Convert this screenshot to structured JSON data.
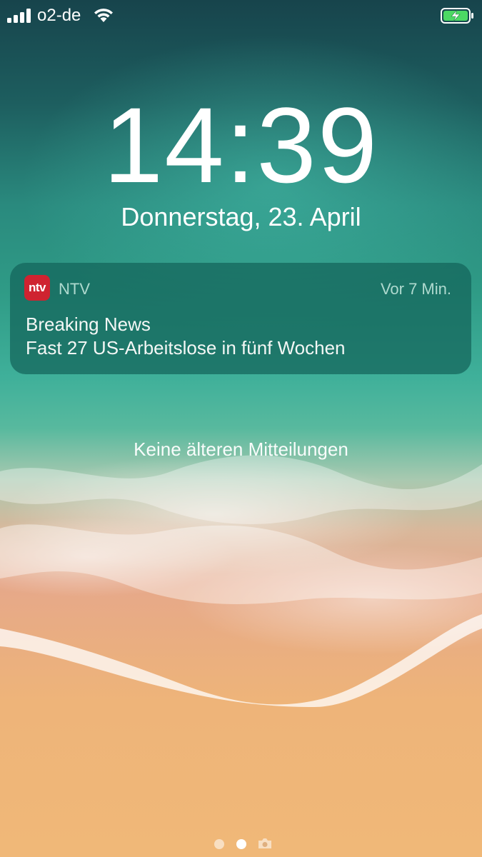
{
  "status_bar": {
    "carrier": "o2-de",
    "signal_bars_filled": 4,
    "signal_icon": "cellular-signal-icon",
    "wifi_icon": "wifi-icon",
    "battery_icon": "battery-charging-icon",
    "battery_color": "#4cd964"
  },
  "lock_screen": {
    "time": "14:39",
    "date": "Donnerstag, 23. April"
  },
  "notification": {
    "app_icon_text": "ntv",
    "app_icon_color": "#cf2330",
    "app_name": "NTV",
    "time_ago": "Vor 7 Min.",
    "title": "Breaking News",
    "body": "Fast 27 US-Arbeitslose in fünf Wochen"
  },
  "notification_center": {
    "empty_label": "Keine älteren Mitteilungen"
  },
  "page_indicator": {
    "pages": 2,
    "active_page": 2,
    "camera_icon": "camera-icon"
  }
}
